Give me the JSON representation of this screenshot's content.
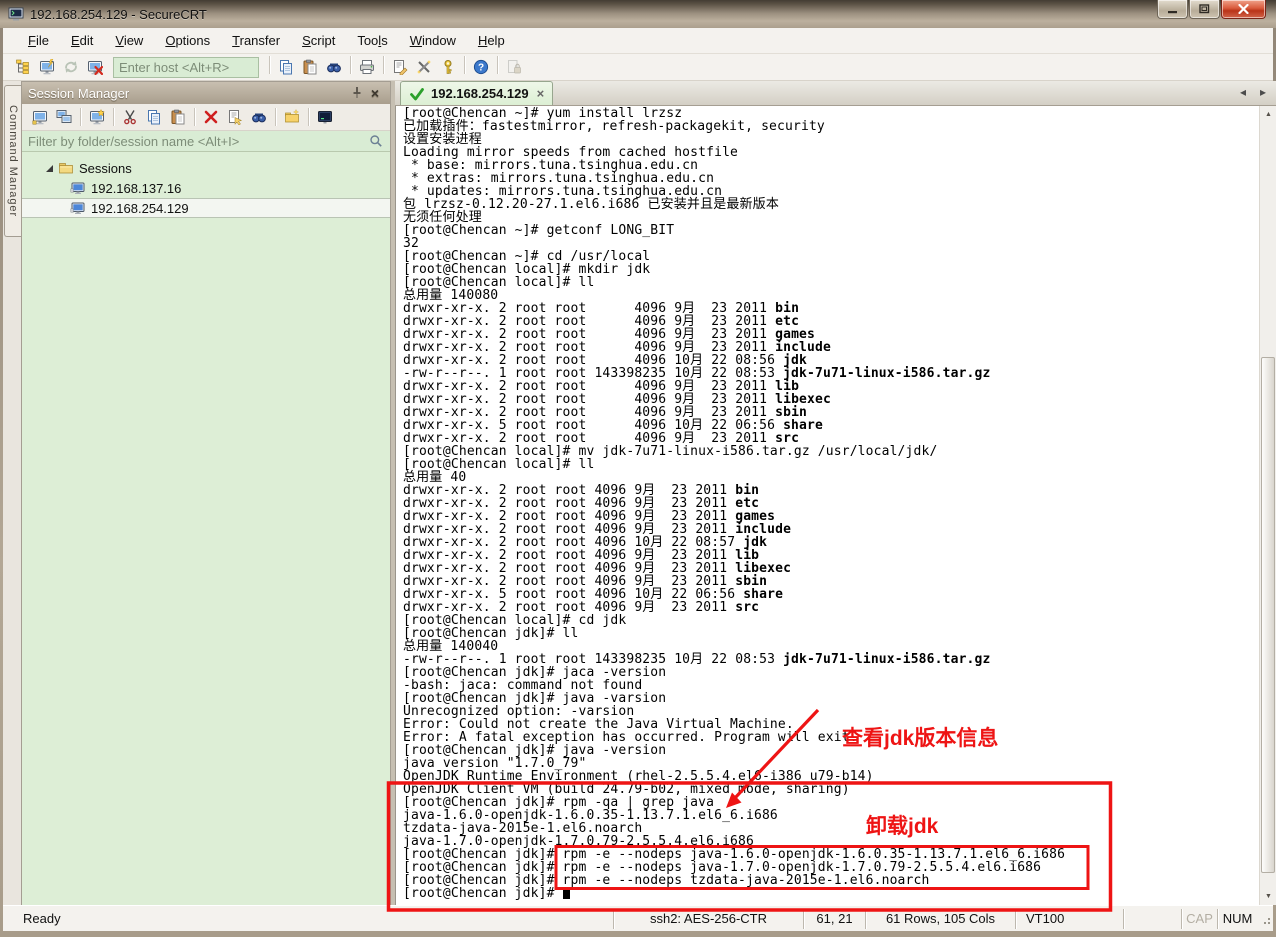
{
  "window": {
    "title": "192.168.254.129 - SecureCRT"
  },
  "menu": {
    "items": [
      {
        "label": "File",
        "accel": 0
      },
      {
        "label": "Edit",
        "accel": 0
      },
      {
        "label": "View",
        "accel": 0
      },
      {
        "label": "Options",
        "accel": 0
      },
      {
        "label": "Transfer",
        "accel": 0
      },
      {
        "label": "Script",
        "accel": 0
      },
      {
        "label": "Tools",
        "accel": 3
      },
      {
        "label": "Window",
        "accel": 0
      },
      {
        "label": "Help",
        "accel": 0
      }
    ]
  },
  "toolbar": {
    "left_icons": [
      "session-manager",
      "quick-connect",
      "reconnect:disabled",
      "disconnect"
    ],
    "host_placeholder": "Enter host <Alt+R>",
    "right_icons": [
      "|",
      "copy",
      "paste",
      "find",
      "|",
      "print",
      "|",
      "session-options",
      "global-options",
      "keygen",
      "|",
      "help",
      "|",
      "lock:disabled"
    ]
  },
  "command_manager": {
    "label": "Command Manager"
  },
  "session_manager": {
    "title": "Session Manager",
    "toolbar_icons": [
      "connect",
      "tabbed-connect",
      "|",
      "wizard",
      "|",
      "cut",
      "copy",
      "paste",
      "|",
      "delete",
      "properties",
      "find",
      "|",
      "new-folder",
      "|",
      "trace"
    ],
    "filter_placeholder": "Filter by folder/session name <Alt+I>",
    "tree": {
      "root": "Sessions",
      "sessions": [
        "192.168.137.16",
        "192.168.254.129"
      ],
      "selected": "192.168.254.129"
    }
  },
  "tab": {
    "label": "192.168.254.129",
    "close": "×"
  },
  "terminal": {
    "lines": [
      "[root@Chencan ~]# yum install lrzsz",
      "已加载插件：fastestmirror, refresh-packagekit, security",
      "设置安装进程",
      "Loading mirror speeds from cached hostfile",
      " * base: mirrors.tuna.tsinghua.edu.cn",
      " * extras: mirrors.tuna.tsinghua.edu.cn",
      " * updates: mirrors.tuna.tsinghua.edu.cn",
      "包 lrzsz-0.12.20-27.1.el6.i686 已安装并且是最新版本",
      "无须任何处理",
      "[root@Chencan ~]# getconf LONG_BIT",
      "32",
      "[root@Chencan ~]# cd /usr/local",
      "[root@Chencan local]# mkdir jdk",
      "[root@Chencan local]# ll",
      "总用量 140080",
      [
        "drwxr-xr-x. 2 root root      4096 9月  23 2011 ",
        {
          "b": "bin"
        }
      ],
      [
        "drwxr-xr-x. 2 root root      4096 9月  23 2011 ",
        {
          "b": "etc"
        }
      ],
      [
        "drwxr-xr-x. 2 root root      4096 9月  23 2011 ",
        {
          "b": "games"
        }
      ],
      [
        "drwxr-xr-x. 2 root root      4096 9月  23 2011 ",
        {
          "b": "include"
        }
      ],
      [
        "drwxr-xr-x. 2 root root      4096 10月 22 08:56 ",
        {
          "b": "jdk"
        }
      ],
      [
        "-rw-r--r--. 1 root root 143398235 10月 22 08:53 ",
        {
          "b": "jdk-7u71-linux-i586.tar.gz"
        }
      ],
      [
        "drwxr-xr-x. 2 root root      4096 9月  23 2011 ",
        {
          "b": "lib"
        }
      ],
      [
        "drwxr-xr-x. 2 root root      4096 9月  23 2011 ",
        {
          "b": "libexec"
        }
      ],
      [
        "drwxr-xr-x. 2 root root      4096 9月  23 2011 ",
        {
          "b": "sbin"
        }
      ],
      [
        "drwxr-xr-x. 5 root root      4096 10月 22 06:56 ",
        {
          "b": "share"
        }
      ],
      [
        "drwxr-xr-x. 2 root root      4096 9月  23 2011 ",
        {
          "b": "src"
        }
      ],
      "[root@Chencan local]# mv jdk-7u71-linux-i586.tar.gz /usr/local/jdk/",
      "[root@Chencan local]# ll",
      "总用量 40",
      [
        "drwxr-xr-x. 2 root root 4096 9月  23 2011 ",
        {
          "b": "bin"
        }
      ],
      [
        "drwxr-xr-x. 2 root root 4096 9月  23 2011 ",
        {
          "b": "etc"
        }
      ],
      [
        "drwxr-xr-x. 2 root root 4096 9月  23 2011 ",
        {
          "b": "games"
        }
      ],
      [
        "drwxr-xr-x. 2 root root 4096 9月  23 2011 ",
        {
          "b": "include"
        }
      ],
      [
        "drwxr-xr-x. 2 root root 4096 10月 22 08:57 ",
        {
          "b": "jdk"
        }
      ],
      [
        "drwxr-xr-x. 2 root root 4096 9月  23 2011 ",
        {
          "b": "lib"
        }
      ],
      [
        "drwxr-xr-x. 2 root root 4096 9月  23 2011 ",
        {
          "b": "libexec"
        }
      ],
      [
        "drwxr-xr-x. 2 root root 4096 9月  23 2011 ",
        {
          "b": "sbin"
        }
      ],
      [
        "drwxr-xr-x. 5 root root 4096 10月 22 06:56 ",
        {
          "b": "share"
        }
      ],
      [
        "drwxr-xr-x. 2 root root 4096 9月  23 2011 ",
        {
          "b": "src"
        }
      ],
      "[root@Chencan local]# cd jdk",
      "[root@Chencan jdk]# ll",
      "总用量 140040",
      [
        "-rw-r--r--. 1 root root 143398235 10月 22 08:53 ",
        {
          "b": "jdk-7u71-linux-i586.tar.gz"
        }
      ],
      "[root@Chencan jdk]# jaca -version",
      "-bash: jaca: command not found",
      "[root@Chencan jdk]# java -varsion",
      "Unrecognized option: -varsion",
      "Error: Could not create the Java Virtual Machine.",
      "Error: A fatal exception has occurred. Program will exit.",
      "[root@Chencan jdk]# java -version",
      "java version \"1.7.0_79\"",
      "OpenJDK Runtime Environment (rhel-2.5.5.4.el6-i386 u79-b14)",
      "OpenJDK Client VM (build 24.79-b02, mixed mode, sharing)",
      "[root@Chencan jdk]# rpm -qa | grep java",
      "java-1.6.0-openjdk-1.6.0.35-1.13.7.1.el6_6.i686",
      "tzdata-java-2015e-1.el6.noarch",
      "java-1.7.0-openjdk-1.7.0.79-2.5.5.4.el6.i686",
      "[root@Chencan jdk]# rpm -e --nodeps java-1.6.0-openjdk-1.6.0.35-1.13.7.1.el6_6.i686",
      "[root@Chencan jdk]# rpm -e --nodeps java-1.7.0-openjdk-1.7.0.79-2.5.5.4.el6.i686",
      "[root@Chencan jdk]# rpm -e --nodeps tzdata-java-2015e-1.el6.noarch",
      [
        "[root@Chencan jdk]# ",
        {
          "cur": true
        }
      ]
    ]
  },
  "annotations": {
    "view_jdk": "查看jdk版本信息",
    "uninstall_jdk": "卸载jdk",
    "color": "#ee1414"
  },
  "statusbar": {
    "ready": "Ready",
    "ssh": "ssh2: AES-256-CTR",
    "cursor_pos": "61, 21",
    "size": "61 Rows, 105 Cols",
    "emulation": "VT100",
    "cap": "CAP",
    "num": "NUM"
  }
}
